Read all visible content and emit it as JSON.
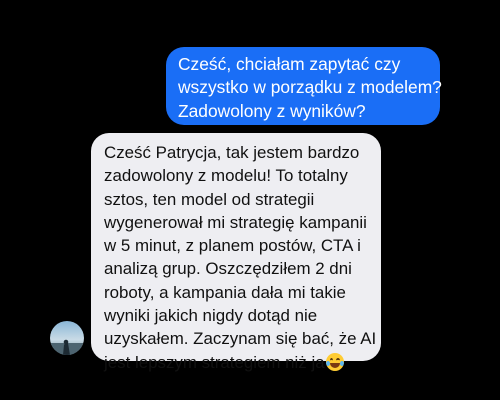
{
  "messages": [
    {
      "sender": "outgoing",
      "lines": [
        "Cześć, chciałam zapytać czy",
        "wszystko w porządku z modelem?",
        "Zadowolony z wyników?"
      ]
    },
    {
      "sender": "incoming",
      "lines": [
        "Cześć Patrycja, tak jestem bardzo",
        "zadowolony z modelu! To totalny",
        "sztos, ten model od strategii",
        "wygenerował mi strategię kampanii",
        "w 5 minut, z planem postów, CTA i",
        "analizą grup. Oszczędziłem 2 dni",
        "roboty, a kampania dała mi takie",
        "wyniki jakich nigdy dotąd nie",
        "uzyskałem. Zaczynam się bać, że AI",
        "jest lepszym strategiem niż ja"
      ],
      "emoji": "😂",
      "emoji_icon": "face-with-tears-of-joy-icon"
    }
  ],
  "colors": {
    "background": "#000000",
    "outgoing_bubble": "#1a6ef6",
    "incoming_bubble": "#eeeef2"
  }
}
